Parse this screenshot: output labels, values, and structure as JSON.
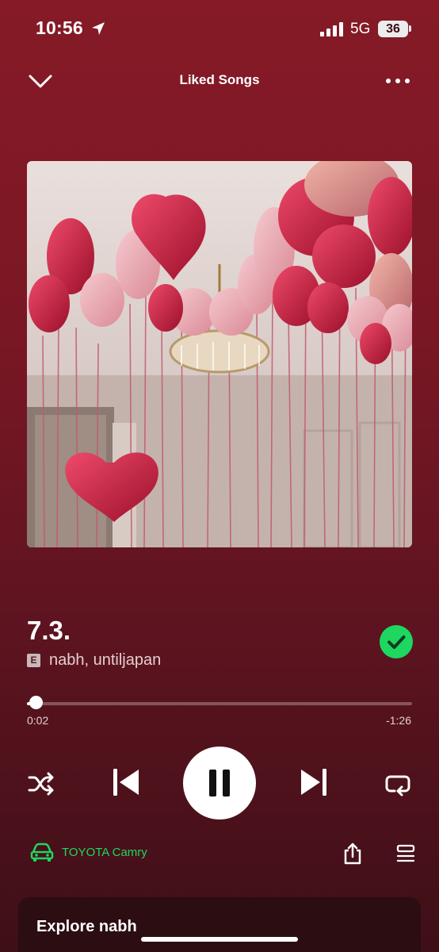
{
  "status_bar": {
    "time": "10:56",
    "network": "5G",
    "battery": "36"
  },
  "header": {
    "title": "Liked Songs"
  },
  "track": {
    "title": "7.3.",
    "explicit_label": "E",
    "artists": "nabh, untiljapan",
    "liked": true
  },
  "progress": {
    "elapsed": "0:02",
    "remaining": "-1:26",
    "fraction": 0.023
  },
  "player": {
    "state": "playing"
  },
  "device": {
    "name": "TOYOTA Camry"
  },
  "explore": {
    "title": "Explore nabh"
  },
  "colors": {
    "accent": "#1ed760",
    "background_top": "#861a27",
    "background_bottom": "#3e0f17"
  },
  "icons": {
    "back": "chevron-down-icon",
    "more": "more-dots-icon",
    "location": "location-arrow-icon",
    "signal": "signal-bars-icon",
    "liked": "check-circle-icon",
    "shuffle": "shuffle-icon",
    "previous": "skip-previous-icon",
    "pause": "pause-icon",
    "next": "skip-next-icon",
    "repeat": "repeat-icon",
    "device": "car-icon",
    "share": "share-icon",
    "queue": "queue-icon"
  }
}
